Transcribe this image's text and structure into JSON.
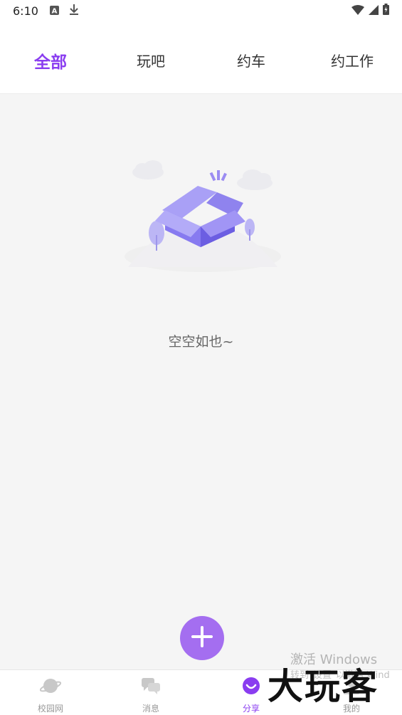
{
  "status_bar": {
    "time": "6:10",
    "left_icons": [
      "font-a-icon",
      "download-icon"
    ],
    "right_icons": [
      "wifi-icon",
      "signal-icon",
      "battery-icon"
    ]
  },
  "tabs": [
    {
      "label": "全部",
      "active": true
    },
    {
      "label": "玩吧",
      "active": false
    },
    {
      "label": "约车",
      "active": false
    },
    {
      "label": "约工作",
      "active": false
    }
  ],
  "empty_state": {
    "icon": "empty-box-icon",
    "text": "空空如也~"
  },
  "fab": {
    "icon": "plus-icon"
  },
  "bottom_nav": [
    {
      "label": "校园网",
      "icon": "planet-icon",
      "active": false
    },
    {
      "label": "消息",
      "icon": "chat-bubbles-icon",
      "active": false
    },
    {
      "label": "分享",
      "icon": "smile-icon",
      "active": true
    },
    {
      "label": "我的",
      "icon": "profile-icon",
      "active": false
    }
  ],
  "watermark": {
    "line1": "激活 Windows",
    "line2": "转到\"设置\"以激活 Wind",
    "logo_text": "大玩客"
  },
  "colors": {
    "accent": "#8a3df0",
    "fab": "#a46ef0",
    "background": "#f5f5f5"
  }
}
